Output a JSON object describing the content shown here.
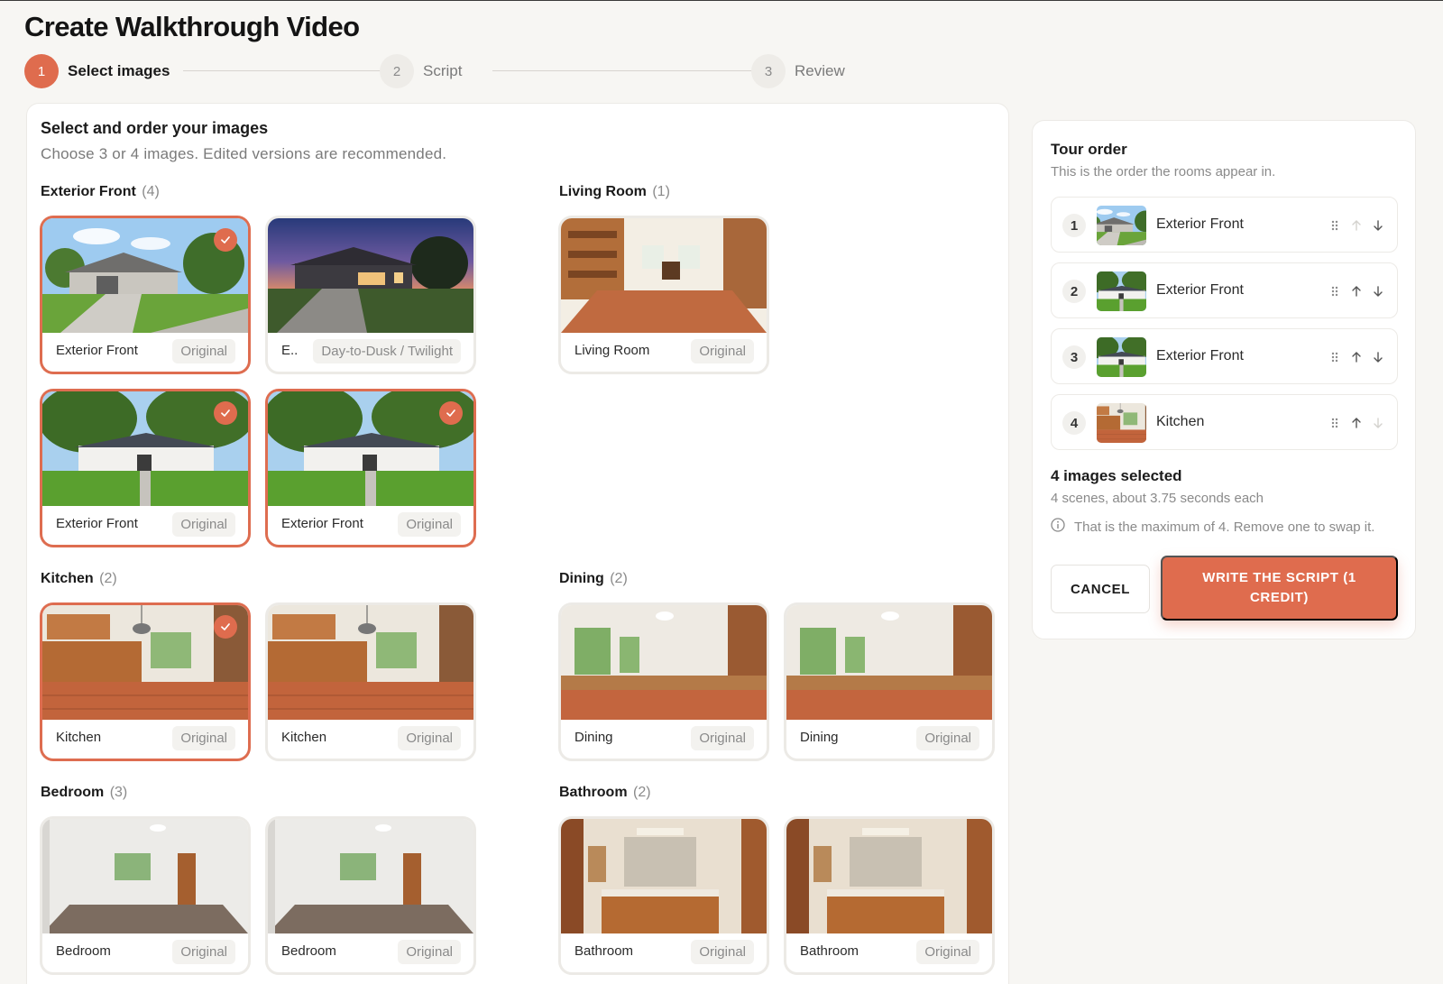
{
  "page": {
    "title": "Create Walkthrough Video"
  },
  "stepper": {
    "steps": [
      {
        "number": "1",
        "label": "Select images"
      },
      {
        "number": "2",
        "label": "Script"
      },
      {
        "number": "3",
        "label": "Review"
      }
    ]
  },
  "selection": {
    "title": "Select and order your images",
    "subtitle": "Choose 3 or 4 images. Edited versions are recommended.",
    "groups": [
      {
        "name": "Exterior Front",
        "count": "(4)"
      },
      {
        "name": "Living Room",
        "count": "(1)"
      },
      {
        "name": "Kitchen",
        "count": "(2)"
      },
      {
        "name": "Dining",
        "count": "(2)"
      },
      {
        "name": "Bedroom",
        "count": "(3)"
      },
      {
        "name": "Bathroom",
        "count": "(2)"
      }
    ],
    "cards": [
      {
        "caption": "Exterior Front",
        "badge": "Original",
        "selected": true,
        "photo": "exterior-day"
      },
      {
        "caption": "E..",
        "badge": "Day-to-Dusk / Twilight",
        "selected": false,
        "photo": "exterior-dusk"
      },
      {
        "caption": "Living Room",
        "badge": "Original",
        "selected": false,
        "photo": "living-room"
      },
      {
        "caption": "Exterior Front",
        "badge": "Original",
        "selected": true,
        "photo": "exterior-trees"
      },
      {
        "caption": "Exterior Front",
        "badge": "Original",
        "selected": true,
        "photo": "exterior-trees"
      },
      {
        "caption": "Kitchen",
        "badge": "Original",
        "selected": true,
        "photo": "kitchen"
      },
      {
        "caption": "Kitchen",
        "badge": "Original",
        "selected": false,
        "photo": "kitchen"
      },
      {
        "caption": "Dining",
        "badge": "Original",
        "selected": false,
        "photo": "dining"
      },
      {
        "caption": "Dining",
        "badge": "Original",
        "selected": false,
        "photo": "dining"
      },
      {
        "caption": "Bedroom",
        "badge": "Original",
        "selected": false,
        "photo": "bedroom"
      },
      {
        "caption": "Bedroom",
        "badge": "Original",
        "selected": false,
        "photo": "bedroom"
      },
      {
        "caption": "Bathroom",
        "badge": "Original",
        "selected": false,
        "photo": "bathroom"
      },
      {
        "caption": "Bathroom",
        "badge": "Original",
        "selected": false,
        "photo": "bathroom"
      }
    ]
  },
  "tour": {
    "title": "Tour order",
    "subtitle": "This is the order the rooms appear in.",
    "items": [
      {
        "index": "1",
        "room": "Exterior Front",
        "photo": "exterior-day"
      },
      {
        "index": "2",
        "room": "Exterior Front",
        "photo": "exterior-trees"
      },
      {
        "index": "3",
        "room": "Exterior Front",
        "photo": "exterior-trees"
      },
      {
        "index": "4",
        "room": "Kitchen",
        "photo": "kitchen"
      }
    ],
    "selected_title": "4 images selected",
    "selected_sub": "4 scenes, about 3.75 seconds each",
    "max_notice": "That is the maximum of 4. Remove one to swap it.",
    "cancel_label": "CANCEL",
    "write_label": "WRITE THE SCRIPT (1 CREDIT)"
  },
  "icons": {
    "check": "check-icon",
    "drag": "drag-handle-icon",
    "up": "arrow-up-icon",
    "down": "arrow-down-icon",
    "info": "info-icon"
  },
  "colors": {
    "accent": "#df6c4e",
    "background": "#f7f6f3"
  }
}
